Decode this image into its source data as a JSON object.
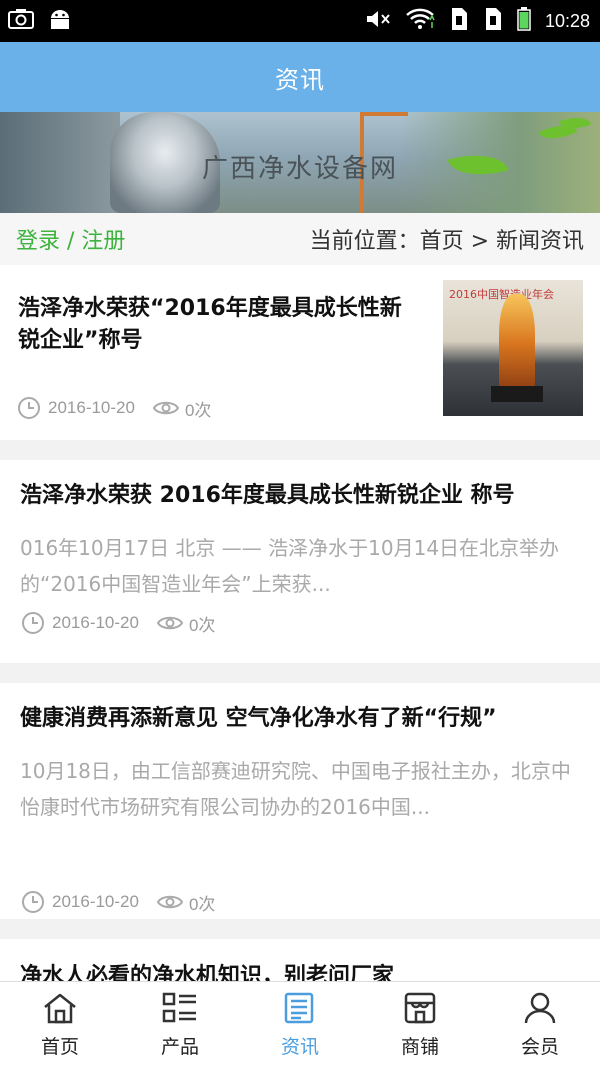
{
  "status_bar": {
    "time": "10:28",
    "icons": [
      "camera-icon",
      "android-icon",
      "mute-icon",
      "wifi-icon",
      "sim1-icon",
      "sim2-icon",
      "battery-icon"
    ]
  },
  "header": {
    "title": "资讯"
  },
  "banner": {
    "title": "广西净水设备网"
  },
  "breadcrumb": {
    "login": "登录 / 注册",
    "location": "当前位置：首页 > 新闻资讯"
  },
  "articles": [
    {
      "title": "浩泽净水荣获“2016年度最具成长性新锐企业”称号",
      "date": "2016-10-20",
      "views": "0次",
      "thumb_text": "2016中国智造业年会"
    },
    {
      "title": "浩泽净水荣获 2016年度最具成长性新锐企业 称号",
      "summary": "016年10月17日 北京 —— 浩泽净水于10月14日在北京举办的“2016中国智造业年会”上荣获...",
      "date": "2016-10-20",
      "views": "0次"
    },
    {
      "title": "健康消费再添新意见 空气净化净水有了新“行规”",
      "summary": "10月18日，由工信部赛迪研究院、中国电子报社主办，北京中怡康时代市场研究有限公司协办的2016中国...",
      "date": "2016-10-20",
      "views": "0次"
    },
    {
      "title": "净水人必看的净水机知识，别老问厂家"
    }
  ],
  "tabs": [
    {
      "label": "首页",
      "icon": "home-icon"
    },
    {
      "label": "产品",
      "icon": "product-grid-icon"
    },
    {
      "label": "资讯",
      "icon": "news-icon",
      "active": true
    },
    {
      "label": "商铺",
      "icon": "shop-icon"
    },
    {
      "label": "会员",
      "icon": "member-icon"
    }
  ],
  "colors": {
    "header_bg": "#6ab1ea",
    "login_green": "#3db33d",
    "active_tab": "#4a9ee0"
  }
}
